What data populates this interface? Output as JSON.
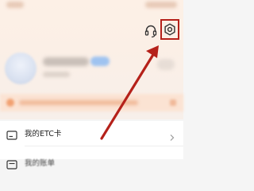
{
  "header": {
    "headset_icon": "headset-icon",
    "settings_icon": "gear-icon",
    "highlight_color": "#b5211a"
  },
  "list": {
    "items": [
      {
        "label": "我的ETC卡",
        "icon": "card-icon"
      },
      {
        "label": "我的账单",
        "icon": "bill-icon"
      }
    ]
  },
  "annotation": {
    "arrow_color": "#b5211a"
  }
}
